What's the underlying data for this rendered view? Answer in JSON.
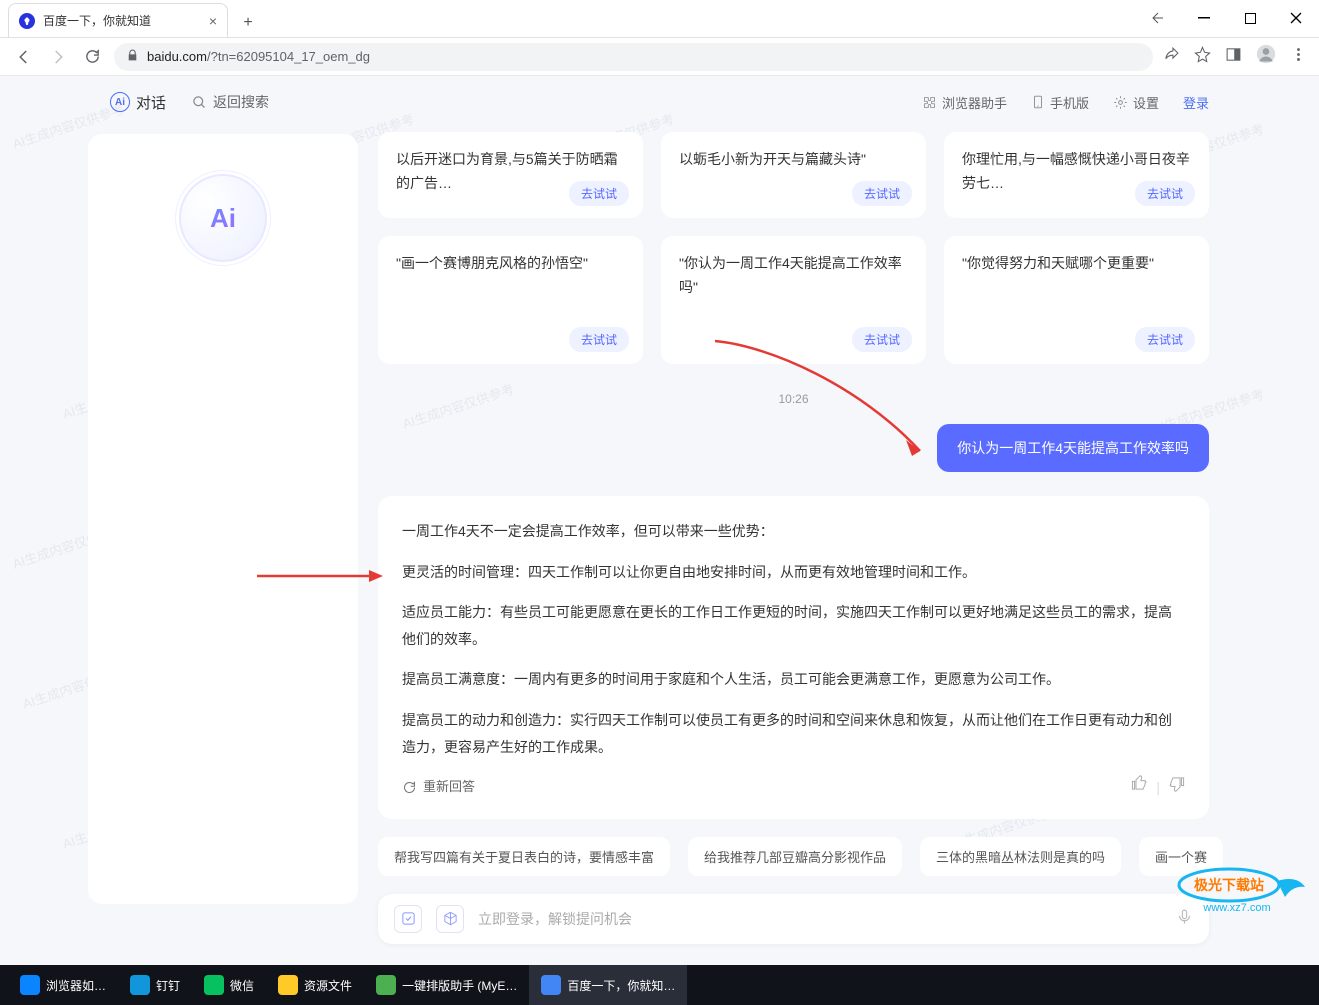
{
  "browser": {
    "tab_title": "百度一下，你就知道",
    "url_domain": "baidu.com",
    "url_path": "/?tn=62095104_17_oem_dg"
  },
  "topbar": {
    "dialog_label": "对话",
    "back_search": "返回搜索",
    "assistant": "浏览器助手",
    "mobile": "手机版",
    "settings": "设置",
    "login": "登录"
  },
  "ai_logo_text": "Ai",
  "suggestion_rows": [
    [
      {
        "text": "以后开迷口为育景,与5篇关于防晒霜的广告…",
        "btn": "去试试"
      },
      {
        "text": "以蛎毛小新为开天与篇藏头诗\"",
        "btn": "去试试"
      },
      {
        "text": "你理忙用,与一幅感慨快递小哥日夜辛劳七…",
        "btn": "去试试"
      }
    ],
    [
      {
        "text": "\"画一个赛博朋克风格的孙悟空\"",
        "btn": "去试试"
      },
      {
        "text": "\"你认为一周工作4天能提高工作效率吗\"",
        "btn": "去试试"
      },
      {
        "text": "\"你觉得努力和天赋哪个更重要\"",
        "btn": "去试试"
      }
    ]
  ],
  "timestamp": "10:26",
  "user_message": "你认为一周工作4天能提高工作效率吗",
  "answer": {
    "p1": "一周工作4天不一定会提高工作效率，但可以带来一些优势：",
    "p2": "更灵活的时间管理：四天工作制可以让你更自由地安排时间，从而更有效地管理时间和工作。",
    "p3": "适应员工能力：有些员工可能更愿意在更长的工作日工作更短的时间，实施四天工作制可以更好地满足这些员工的需求，提高他们的效率。",
    "p4": "提高员工满意度：一周内有更多的时间用于家庭和个人生活，员工可能会更满意工作，更愿意为公司工作。",
    "p5": "提高员工的动力和创造力：实行四天工作制可以使员工有更多的时间和空间来休息和恢复，从而让他们在工作日更有动力和创造力，更容易产生好的工作成果。",
    "regen": "重新回答"
  },
  "chips": [
    "帮我写四篇有关于夏日表白的诗，要情感丰富",
    "给我推荐几部豆瓣高分影视作品",
    "三体的黑暗丛林法则是真的吗",
    "画一个赛"
  ],
  "input_placeholder": "立即登录，解锁提问机会",
  "watermark_text": "AI生成内容仅供参考",
  "taskbar": {
    "items": [
      {
        "label": "浏览器如…",
        "color": "#0a84ff"
      },
      {
        "label": "钉钉",
        "color": "#1296db"
      },
      {
        "label": "微信",
        "color": "#07c160"
      },
      {
        "label": "资源文件",
        "color": "#ffca28"
      },
      {
        "label": "一键排版助手 (MyE…",
        "color": "#4caf50"
      },
      {
        "label": "百度一下，你就知…",
        "color": "#4285f4"
      }
    ]
  },
  "badge": {
    "line1": "极光下载站",
    "line2": "www.xz7.com"
  }
}
